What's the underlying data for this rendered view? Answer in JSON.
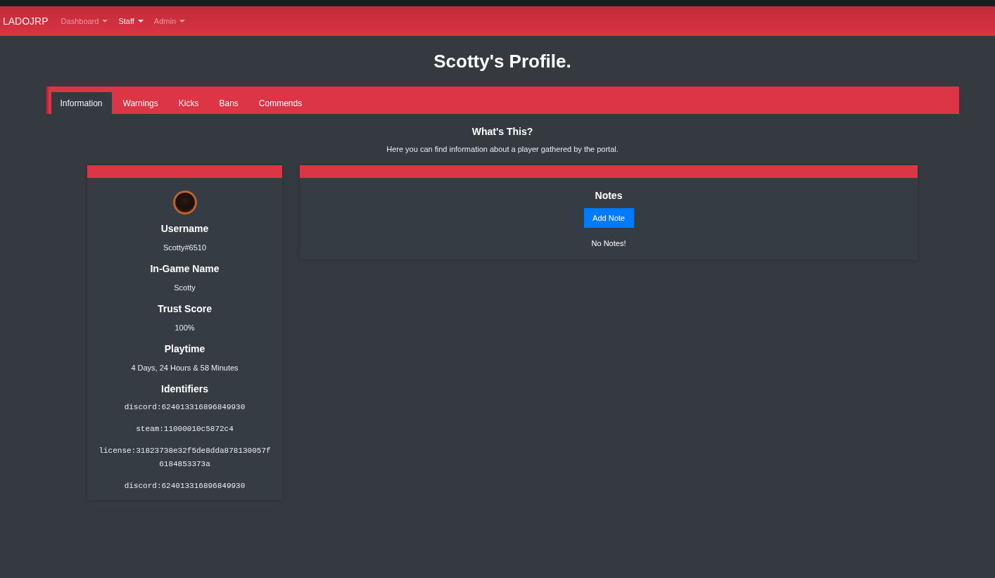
{
  "navbar": {
    "brand": "LADOJRP",
    "items": [
      {
        "label": "Dashboard",
        "selected": false
      },
      {
        "label": "Staff",
        "selected": true
      },
      {
        "label": "Admin",
        "selected": false
      }
    ]
  },
  "page_title": "Scotty's Profile.",
  "tabs": [
    {
      "label": "Information",
      "selected": true
    },
    {
      "label": "Warnings",
      "selected": false
    },
    {
      "label": "Kicks",
      "selected": false
    },
    {
      "label": "Bans",
      "selected": false
    },
    {
      "label": "Commends",
      "selected": false
    }
  ],
  "intro": {
    "heading": "What's This?",
    "text": "Here you can find information about a player gathered by the portal."
  },
  "profile": {
    "fields": [
      {
        "label": "Username",
        "value": "Scotty#6510"
      },
      {
        "label": "In-Game Name",
        "value": "Scotty"
      },
      {
        "label": "Trust Score",
        "value": "100%"
      },
      {
        "label": "Playtime",
        "value": "4 Days, 24 Hours & 58 Minutes"
      }
    ],
    "identifiers": {
      "label": "Identifiers",
      "values": [
        "discord:624013316896849930",
        "steam:11000010c5872c4",
        "license:31823738e32f5de8dda878130057f6184853373a",
        "discord:624013316896849930"
      ]
    }
  },
  "notes": {
    "title": "Notes",
    "button": "Add Note",
    "empty_text": "No Notes!"
  }
}
